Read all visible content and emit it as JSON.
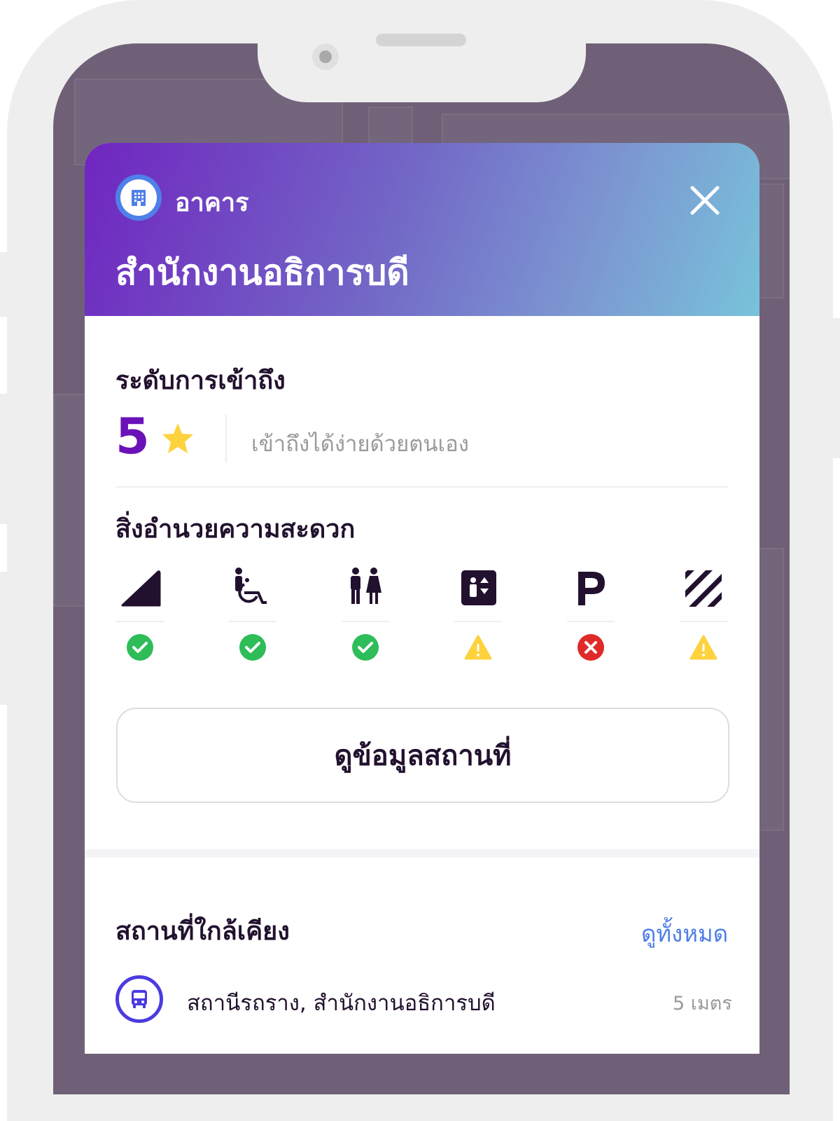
{
  "header": {
    "type_label": "อาคาร",
    "title": "สำนักงานอธิการบดี",
    "type_icon": "building-icon",
    "close_icon": "close-icon",
    "gradient_colors": [
      "#7025c0",
      "#7266c6",
      "#78c3da"
    ]
  },
  "access": {
    "heading": "ระดับการเข้าถึง",
    "level": "5",
    "star_icon": "star-icon",
    "description": "เข้าถึงได้ง่ายด้วยตนเอง",
    "level_color": "#6a12b8",
    "star_color": "#fdd23c"
  },
  "facilities": {
    "heading": "สิ่งอำนวยความสะดวก",
    "items": [
      {
        "icon": "ramp-icon",
        "status": "available"
      },
      {
        "icon": "wheelchair-icon",
        "status": "available"
      },
      {
        "icon": "restroom-icon",
        "status": "available"
      },
      {
        "icon": "elevator-icon",
        "status": "warning"
      },
      {
        "icon": "parking-icon",
        "status": "unavailable"
      },
      {
        "icon": "tactile-paving-icon",
        "status": "warning"
      }
    ],
    "status_colors": {
      "available": "#2ebd59",
      "warning": "#fdd23c",
      "unavailable": "#e02a2a"
    }
  },
  "view_button_label": "ดูข้อมูลสถานที่",
  "nearby": {
    "heading": "สถานที่ใกล้เคียง",
    "view_all": "ดูทั้งหมด",
    "items": [
      {
        "icon": "bus-icon",
        "name": "สถานีรถราง, สำนักงานอธิการบดี",
        "distance": "5 เมตร"
      }
    ]
  },
  "colors": {
    "accent_blue": "#4f7fe8",
    "text_dark": "#22112e",
    "bus_ring": "#4b3be0"
  }
}
